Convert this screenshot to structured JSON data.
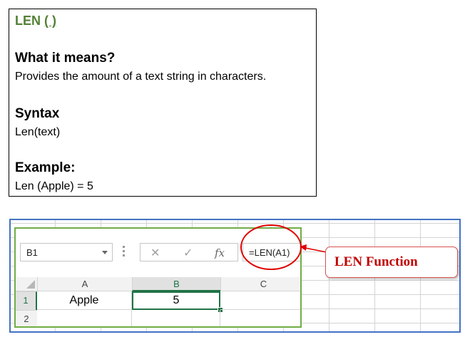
{
  "definition": {
    "function_name": "LEN",
    "parens": "( )",
    "meaning_heading": "What it means?",
    "meaning_text": "Provides the amount of a text string in characters.",
    "syntax_heading": "Syntax",
    "syntax_text": "Len(text)",
    "example_heading": "Example:",
    "example_text": "Len (Apple) = 5"
  },
  "excel": {
    "name_box": "B1",
    "formula": "=LEN(A1)",
    "cancel_glyph": "✕",
    "enter_glyph": "✓",
    "fx_glyph": "fx",
    "columns": [
      "A",
      "B",
      "C"
    ],
    "rows": [
      "1",
      "2"
    ],
    "cells": {
      "A1": "Apple",
      "B1": "5"
    },
    "selected_cell": "B1"
  },
  "annotation": {
    "callout_label": "LEN Function"
  },
  "colors": {
    "title_green": "#538135",
    "excel_green": "#217346",
    "frame_blue": "#4472c4",
    "annotation_red": "#c00000"
  }
}
